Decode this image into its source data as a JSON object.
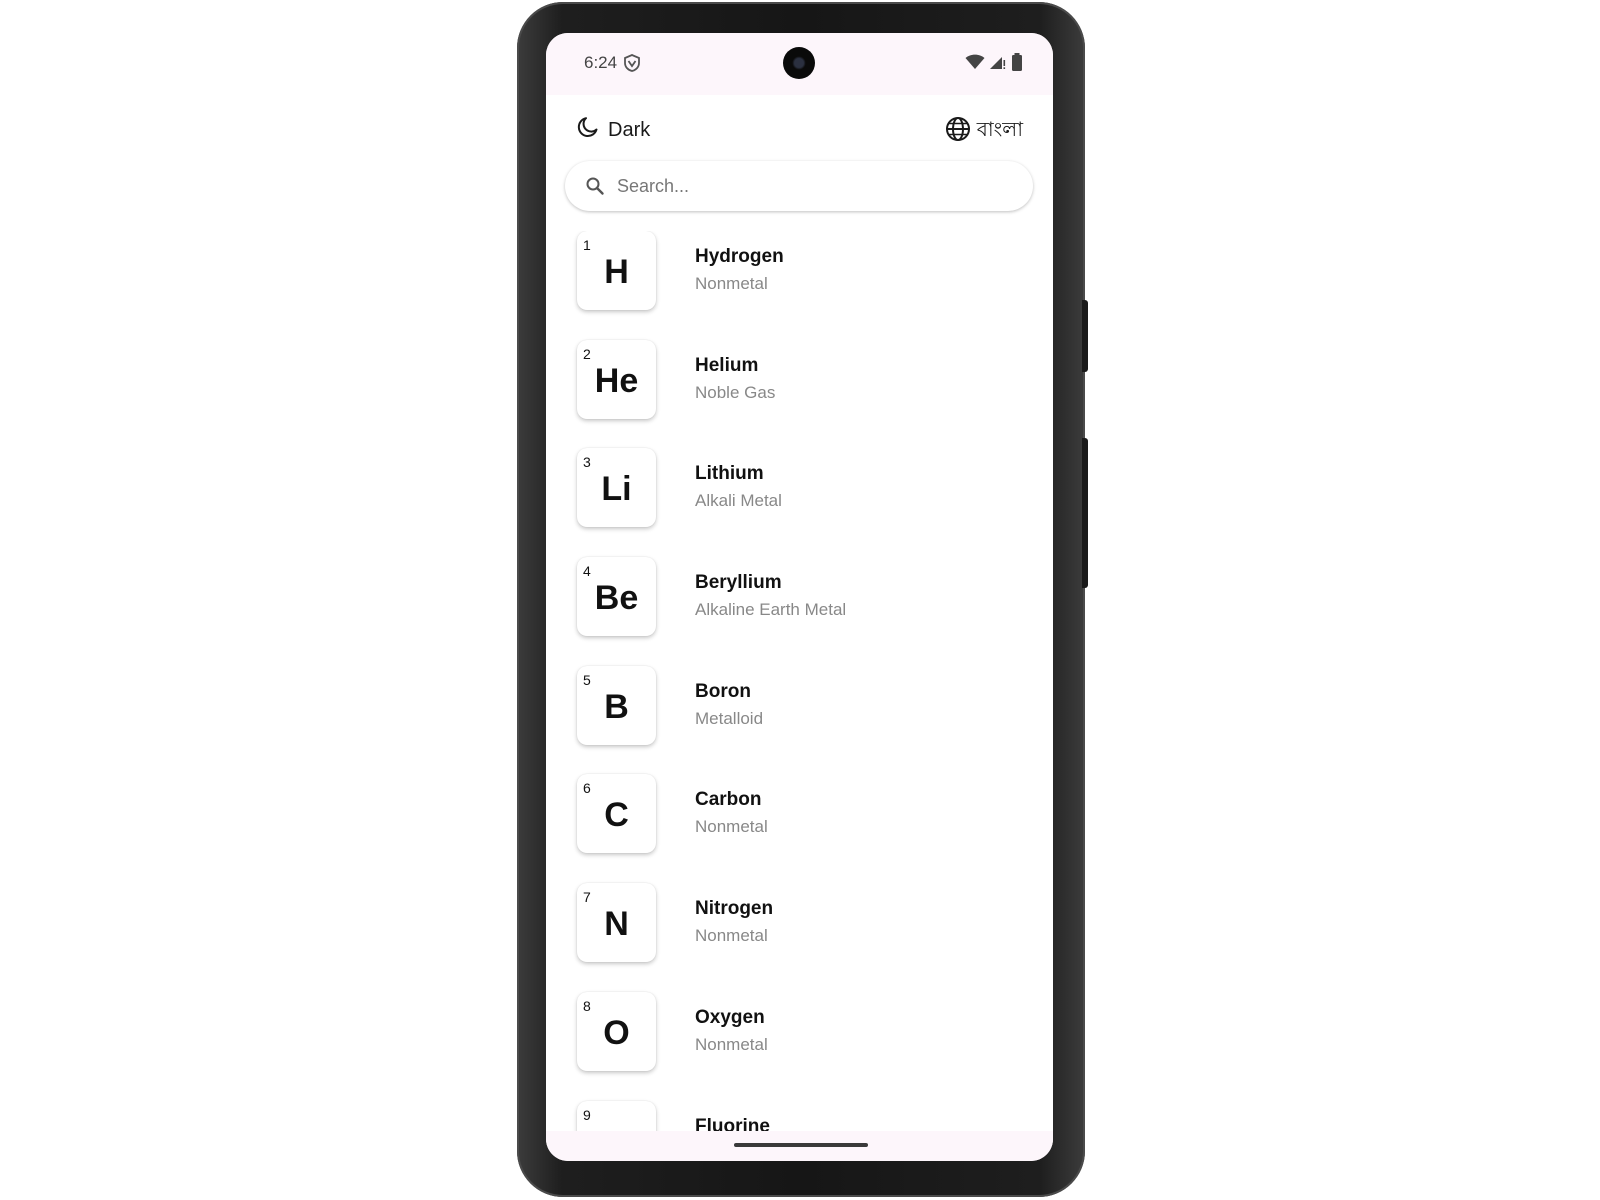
{
  "status_bar": {
    "time": "6:24"
  },
  "topbar": {
    "theme_label": "Dark",
    "language_label": "বাংলা"
  },
  "search": {
    "placeholder": "Search..."
  },
  "elements": [
    {
      "number": "1",
      "symbol": "H",
      "name": "Hydrogen",
      "category": "Nonmetal"
    },
    {
      "number": "2",
      "symbol": "He",
      "name": "Helium",
      "category": "Noble Gas"
    },
    {
      "number": "3",
      "symbol": "Li",
      "name": "Lithium",
      "category": "Alkali Metal"
    },
    {
      "number": "4",
      "symbol": "Be",
      "name": "Beryllium",
      "category": "Alkaline Earth Metal"
    },
    {
      "number": "5",
      "symbol": "B",
      "name": "Boron",
      "category": "Metalloid"
    },
    {
      "number": "6",
      "symbol": "C",
      "name": "Carbon",
      "category": "Nonmetal"
    },
    {
      "number": "7",
      "symbol": "N",
      "name": "Nitrogen",
      "category": "Nonmetal"
    },
    {
      "number": "8",
      "symbol": "O",
      "name": "Oxygen",
      "category": "Nonmetal"
    },
    {
      "number": "9",
      "symbol": "",
      "name": "Fluorine",
      "category": ""
    }
  ],
  "icons": {
    "theme": "moon-icon",
    "language": "globe-icon",
    "search": "search-icon",
    "status": [
      "vpn-shield-icon",
      "wifi-icon",
      "cellular-signal-icon",
      "battery-icon"
    ]
  },
  "colors": {
    "status_bar_bg": "#fdf6fb",
    "text_primary": "#111111",
    "text_secondary": "#888888"
  }
}
